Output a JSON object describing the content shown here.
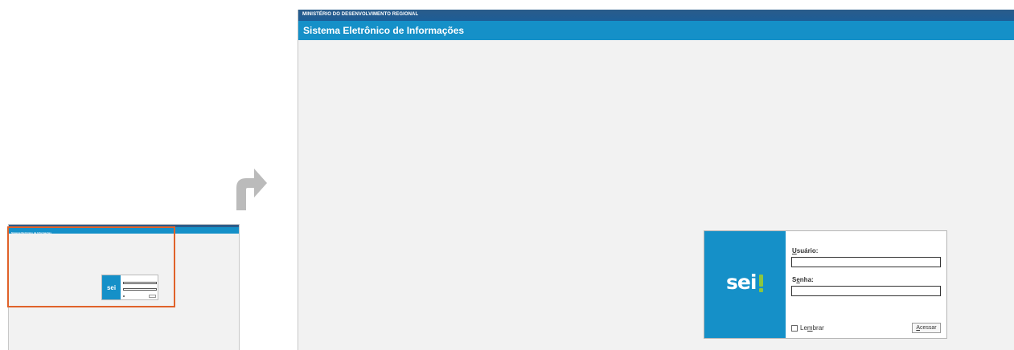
{
  "thumbnail": {
    "title": "Sistema Eletrônico de Informações",
    "logo": "sei"
  },
  "arrow": {
    "icon": "curved-arrow-right-icon",
    "color": "#bbbbbb"
  },
  "header": {
    "ministry": "MINISTÉRIO DO DESENVOLVIMENTO REGIONAL",
    "system_title": "Sistema Eletrônico de Informações"
  },
  "login": {
    "logo_text": "sei",
    "user_label_accesskey": "U",
    "user_label_rest": "suário:",
    "user_value": "",
    "password_label_first": "S",
    "password_label_accesskey": "e",
    "password_label_rest": "nha:",
    "password_value": "",
    "remember_prefix": "Le",
    "remember_accesskey": "m",
    "remember_suffix": "brar",
    "remember_checked": false,
    "submit_accesskey": "A",
    "submit_rest": "cessar"
  },
  "colors": {
    "brand_blue": "#1590c8",
    "dark_blue": "#2b5c8a",
    "accent_green": "#8cc63f",
    "highlight_orange": "#e0622a",
    "page_bg": "#f2f2f2"
  }
}
